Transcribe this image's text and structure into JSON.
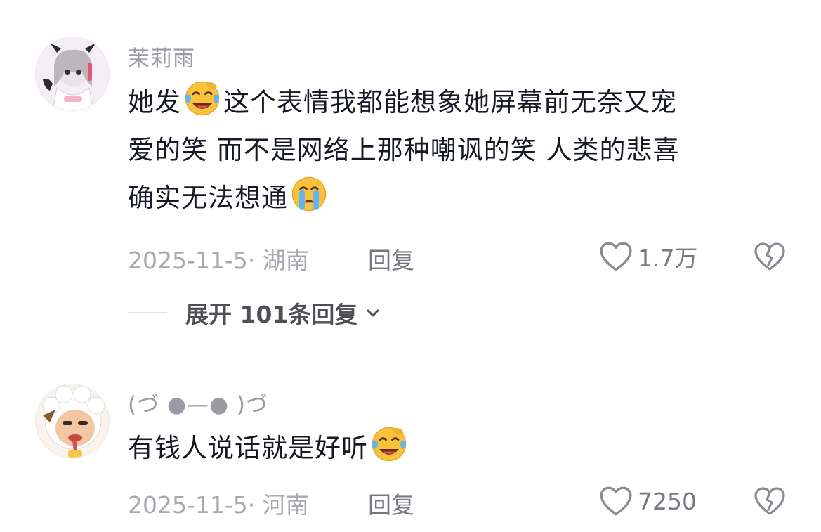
{
  "comments": [
    {
      "username": "茉莉雨",
      "text_parts": [
        "她发",
        "这个表情我都能想象她屏幕前无奈又宠",
        "爱的笑 而不是网络上那种嘲讽的笑 人类的悲喜",
        "确实无法想通"
      ],
      "emojis": [
        "laughing-crying-emoji",
        "loudly-crying-emoji"
      ],
      "date_location": "2025-11-5· 湖南",
      "reply_label": "回复",
      "like_count": "1.7万",
      "expand_replies_label": "展开 101条回复"
    },
    {
      "username": "(づ ●—● )づ",
      "text": "有钱人说话就是好听",
      "emojis": [
        "laughing-crying-emoji"
      ],
      "date_location": "2025-11-5· 河南",
      "reply_label": "回复",
      "like_count": "7250"
    }
  ],
  "colors": {
    "text_primary": "#161823",
    "text_secondary": "#9a9aa1",
    "meta": "#a8a8ae",
    "emoji_yellow": "#f9c23c",
    "tear_blue": "#5fb5f2"
  }
}
